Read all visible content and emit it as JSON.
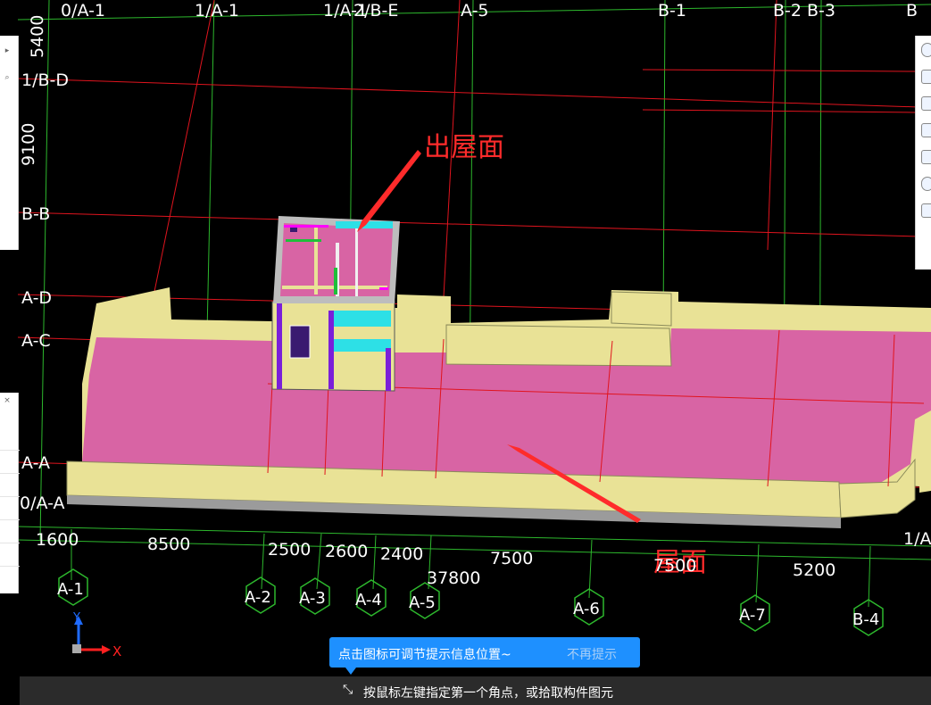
{
  "axes_top": [
    "0/A-1",
    "1/A-1",
    "1/A-1",
    "2/B-E",
    "A-5",
    "B-1",
    "B-2",
    "B-3",
    "B"
  ],
  "axes_left": [
    "5400",
    "1/B-D",
    "9100",
    "B-B",
    "A-D",
    "A-C",
    "A-A",
    "0/A-A"
  ],
  "axes_right": [
    "1/A"
  ],
  "axis_bubbles": [
    "A-1",
    "A-2",
    "A-3",
    "A-4",
    "A-5",
    "A-6",
    "A-7",
    "B-4"
  ],
  "dimensions": [
    "1600",
    "8500",
    "2500",
    "2600",
    "2400",
    "7500",
    "37800",
    "7500",
    "5200"
  ],
  "annotations": {
    "roof_top": "出屋面",
    "roof": "屋面"
  },
  "ucs": {
    "y": "Y",
    "x": "X"
  },
  "tooltip": {
    "message": "点击图标可调节提示信息位置~",
    "dismiss": "不再提示"
  },
  "status": {
    "text": "按鼠标左键指定第一个角点，或拾取构件图元"
  },
  "colors": {
    "axis_green": "#2db82d",
    "grid_red": "#e0141e",
    "roof_pink": "#d864a4",
    "wall_yellow": "#e9e296",
    "accent_cyan": "#2de0e6",
    "column_violet": "#7a1fd9",
    "annotation_red": "#ff2b2b",
    "tip_blue": "#1e90ff"
  }
}
